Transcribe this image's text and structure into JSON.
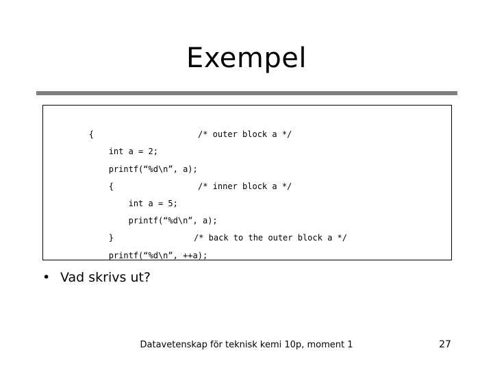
{
  "slide": {
    "title": "Exempel",
    "divider_color": "#808080",
    "background_color": "#ffffff",
    "text_color": "#000000"
  },
  "code_block": {
    "border_color": "#000000",
    "lines": [
      {
        "code": "{",
        "comment": ""
      },
      {
        "code": "    int a = 2;",
        "comment": "/* outer block a */"
      },
      {
        "code": "    printf(“%d\\n”, a);",
        "comment": ""
      },
      {
        "code": "    {",
        "comment": ""
      },
      {
        "code": "        int a = 5;",
        "comment": "/* inner block a */"
      },
      {
        "code": "        printf(“%d\\n”, a);",
        "comment": ""
      },
      {
        "code": "    }",
        "comment": ""
      },
      {
        "code": "    printf(“%d\\n”, ++a);",
        "comment": "/* back to the outer block a */"
      },
      {
        "code": "}",
        "comment": ""
      }
    ]
  },
  "bullets": [
    {
      "marker": "•",
      "text": "Vad skrivs ut?"
    }
  ],
  "footer": {
    "text": "Datavetenskap för teknisk kemi 10p, moment 1",
    "page_number": "27"
  }
}
